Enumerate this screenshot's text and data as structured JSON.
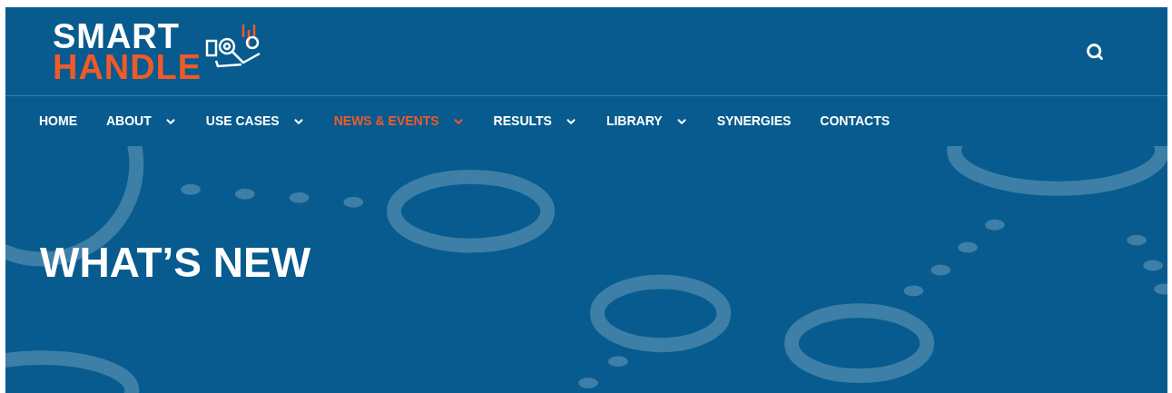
{
  "logo": {
    "line_1": "SMART",
    "line_2": "HANDLE"
  },
  "nav": [
    {
      "label": "HOME",
      "selected": false,
      "has_dropdown": false
    },
    {
      "label": "ABOUT",
      "selected": false,
      "has_dropdown": true
    },
    {
      "label": "USE CASES",
      "selected": false,
      "has_dropdown": true
    },
    {
      "label": "NEWS & EVENTS",
      "selected": true,
      "has_dropdown": true
    },
    {
      "label": "RESULTS",
      "selected": false,
      "has_dropdown": true
    },
    {
      "label": "LIBRARY",
      "selected": false,
      "has_dropdown": true
    },
    {
      "label": "SYNERGIES",
      "selected": false,
      "has_dropdown": false
    },
    {
      "label": "CONTACTS",
      "selected": false,
      "has_dropdown": false
    }
  ],
  "hero": {
    "title": "WHAT’S NEW"
  }
}
